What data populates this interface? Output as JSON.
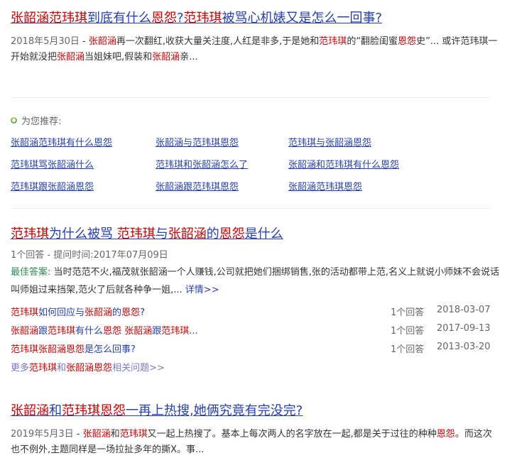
{
  "result1": {
    "title_parts": [
      {
        "t": "张韶涵范玮琪",
        "hl": true
      },
      {
        "t": "到底有什么",
        "hl": false
      },
      {
        "t": "恩怨",
        "hl": true
      },
      {
        "t": "?",
        "hl": false
      },
      {
        "t": "范玮琪",
        "hl": true
      },
      {
        "t": "被骂心机婊又是怎么一回事?",
        "hl": false
      }
    ],
    "date": "2018年5月30日",
    "abstract_parts": [
      {
        "t": " - ",
        "hl": false
      },
      {
        "t": "张韶涵",
        "hl": true
      },
      {
        "t": "再一次翻红,收获大量关注度,人红是非多,于是她和",
        "hl": false
      },
      {
        "t": "范玮琪",
        "hl": true
      },
      {
        "t": "的“翻脸闺蜜",
        "hl": false
      },
      {
        "t": "恩怨",
        "hl": true
      },
      {
        "t": "史”... 或许范玮琪一开始就没把",
        "hl": false
      },
      {
        "t": "张韶涵",
        "hl": true
      },
      {
        "t": "当姐妹吧,假装和",
        "hl": false
      },
      {
        "t": "张韶涵",
        "hl": true
      },
      {
        "t": "亲...",
        "hl": false
      }
    ]
  },
  "recommend": {
    "heading": "为您推荐:",
    "rows": [
      [
        "张韶涵范玮琪有什么恩怨",
        "张韶涵与范玮琪恩怨",
        "范玮琪与张韶涵恩怨"
      ],
      [
        "范玮琪骂张韶涵什么",
        "范玮琪和张韶涵怎么了",
        "张韶涵和范玮琪有什么恩怨"
      ],
      [
        "范玮琪跟张韶涵恩怨",
        "张韶涵跟范玮琪恩怨",
        "张韶涵范玮琪恩怨"
      ]
    ]
  },
  "result2": {
    "title_parts": [
      {
        "t": "范玮琪",
        "hl": true
      },
      {
        "t": "为什么被骂 ",
        "hl": false
      },
      {
        "t": "范玮琪",
        "hl": true
      },
      {
        "t": "与",
        "hl": false
      },
      {
        "t": "张韶涵",
        "hl": true
      },
      {
        "t": "的",
        "hl": false
      },
      {
        "t": "恩怨",
        "hl": true
      },
      {
        "t": "是什么",
        "hl": false
      }
    ],
    "meta": "1个回答 - 提问时间:2017年07月09日",
    "best_label": "最佳答案:",
    "best_parts": [
      {
        "t": " 当时范范不火,福茂就",
        "hl": false
      },
      {
        "t": "张韶涵",
        "hl": true
      },
      {
        "t": "一个人赚钱,公司就把她们捆绑销售,张的活动都带上范,名义上就说小师妹不会说话叫师姐过来挡架,范火了后就各种争一姐,... ",
        "hl": false
      }
    ],
    "detail_link": "详情>>",
    "questions": [
      {
        "parts": [
          {
            "t": "范玮琪",
            "hl": true
          },
          {
            "t": "如何回应与",
            "hl": false
          },
          {
            "t": "张韶涵",
            "hl": true
          },
          {
            "t": "的",
            "hl": false
          },
          {
            "t": "恩怨",
            "hl": true
          },
          {
            "t": "?",
            "hl": false
          }
        ],
        "count": "1个回答",
        "date": "2018-03-07"
      },
      {
        "parts": [
          {
            "t": "张韶涵",
            "hl": true
          },
          {
            "t": "跟",
            "hl": false
          },
          {
            "t": "范玮琪",
            "hl": true
          },
          {
            "t": "有什么",
            "hl": false
          },
          {
            "t": "恩怨",
            "hl": true
          },
          {
            "t": " ",
            "hl": false
          },
          {
            "t": "张韶涵",
            "hl": true
          },
          {
            "t": "跟",
            "hl": false
          },
          {
            "t": "范玮琪",
            "hl": true
          },
          {
            "t": "...",
            "hl": false
          }
        ],
        "count": "1个回答",
        "date": "2017-09-13"
      },
      {
        "parts": [
          {
            "t": "范玮琪张韶涵恩怨",
            "hl": true
          },
          {
            "t": "是怎么回事?",
            "hl": false
          }
        ],
        "count": "1个回答",
        "date": "2013-03-20"
      }
    ],
    "more_parts": [
      {
        "t": "更多",
        "hl": false
      },
      {
        "t": "范玮琪",
        "hl": true
      },
      {
        "t": "和",
        "hl": false
      },
      {
        "t": "张韶涵恩怨",
        "hl": true
      },
      {
        "t": "相关问题>>",
        "hl": false
      }
    ]
  },
  "result3": {
    "title_parts": [
      {
        "t": "张韶涵",
        "hl": true
      },
      {
        "t": "和",
        "hl": false
      },
      {
        "t": "范玮琪",
        "hl": true
      },
      {
        "t": "恩怨",
        "hl": true
      },
      {
        "t": "一再上热搜,她俩究竟有完没完?",
        "hl": false
      }
    ],
    "date": "2019年5月3日",
    "abstract_parts": [
      {
        "t": " - ",
        "hl": false
      },
      {
        "t": "张韶涵",
        "hl": true
      },
      {
        "t": "和",
        "hl": false
      },
      {
        "t": "范玮琪",
        "hl": true
      },
      {
        "t": "又一起上热搜了。基本上每次两人的名字放在一起,都是关于过往的种种",
        "hl": false
      },
      {
        "t": "恩怨",
        "hl": true
      },
      {
        "t": "。而这次也不例外,主题同样是一场拉扯多年的撕X。事...",
        "hl": false
      }
    ]
  }
}
